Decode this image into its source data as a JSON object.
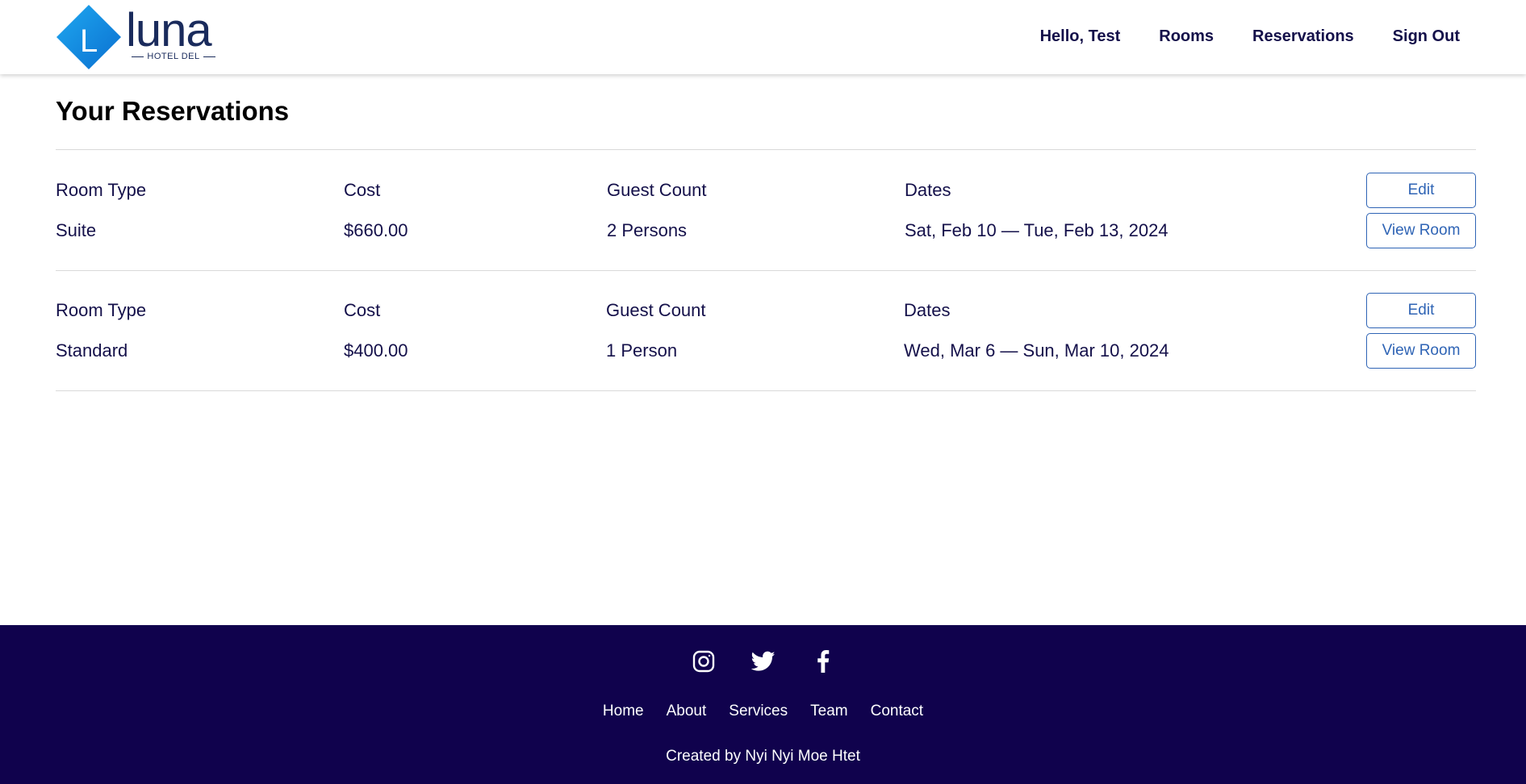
{
  "header": {
    "logo": {
      "word": "luna",
      "subtitle": "HOTEL DEL",
      "mark_letter": "L"
    },
    "nav": [
      "Hello, Test",
      "Rooms",
      "Reservations",
      "Sign Out"
    ]
  },
  "main": {
    "title": "Your Reservations",
    "reservations": [
      {
        "labels": {
          "room_type": "Room Type",
          "cost": "Cost",
          "guest_count": "Guest Count",
          "dates": "Dates"
        },
        "room_type": "Suite",
        "cost": "$660.00",
        "guest_count": "2 Persons",
        "dates": "Sat, Feb 10 — Tue, Feb 13, 2024",
        "edit_label": "Edit",
        "view_label": "View Room"
      },
      {
        "labels": {
          "room_type": "Room Type",
          "cost": "Cost",
          "guest_count": "Guest Count",
          "dates": "Dates"
        },
        "room_type": "Standard",
        "cost": "$400.00",
        "guest_count": "1 Person",
        "dates": "Wed, Mar 6 — Sun, Mar 10, 2024",
        "edit_label": "Edit",
        "view_label": "View Room"
      }
    ]
  },
  "footer": {
    "social_icons": [
      "instagram-icon",
      "twitter-icon",
      "facebook-icon"
    ],
    "links": [
      "Home",
      "About",
      "Services",
      "Team",
      "Contact"
    ],
    "credit": "Created by Nyi Nyi Moe Htet"
  },
  "colors": {
    "navy": "#10024d",
    "text": "#14104a",
    "button_blue": "#2f64b5",
    "logo_blue": "#0a8de0"
  }
}
